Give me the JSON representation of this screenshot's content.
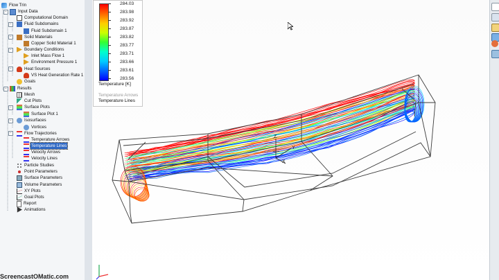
{
  "tree": {
    "root": "Flow Trin",
    "input_data": "Input Data",
    "computational_domain": "Computational Domain",
    "fluid_subdomains": "Fluid Subdomains",
    "fluid_subdomain_1": "Fluid Subdomain 1",
    "solid_materials": "Solid Materials",
    "copper_solid_material_1": "Copper Solid Material 1",
    "boundary_conditions": "Boundary Conditions",
    "inlet_mass_flow_1": "Inlet Mass Flow 1",
    "environment_pressure_1": "Environment Pressure 1",
    "heat_sources": "Heat Sources",
    "vs_heat_generation_rate_1": "VS Heat Generation Rate 1",
    "goals": "Goals",
    "results": "Results",
    "mesh": "Mesh",
    "cut_plots": "Cut Plots",
    "surface_plots": "Surface Plots",
    "surface_plot_1": "Surface Plot 1",
    "isosurfaces": "Isosurfaces",
    "vortices": "Vortices",
    "flow_trajectories": "Flow Trajectories",
    "temperature_arrows": "Temperature Arrows",
    "temperature_lines": "Temperature Lines",
    "velocity_arrows": "Velocity Arrows",
    "velocity_lines": "Velocity Lines",
    "particle_studies": "Particle Studies",
    "point_parameters": "Point Parameters",
    "surface_parameters": "Surface Parameters",
    "volume_parameters": "Volume Parameters",
    "xy_plots": "XY Plots",
    "goal_plots": "Goal Plots",
    "report": "Report",
    "animations": "Animations"
  },
  "legend": {
    "ticks": [
      "284.03",
      "283.98",
      "283.92",
      "283.87",
      "283.82",
      "283.77",
      "283.71",
      "283.66",
      "283.61",
      "283.56"
    ],
    "title": "Temperature [K]",
    "close_glyph": "K",
    "option_temperature_arrows": "Temperature Arrows",
    "option_temperature_lines": "Temperature Lines",
    "colors": [
      "#ff0000",
      "#ff6600",
      "#ffcc00",
      "#ccff00",
      "#33ff33",
      "#00ffcc",
      "#00ccff",
      "#0066ff",
      "#0000ff"
    ]
  },
  "triad": {
    "x": "X",
    "y": "Y",
    "z": "Z"
  },
  "watermark": "ScreencastOMatic.com"
}
